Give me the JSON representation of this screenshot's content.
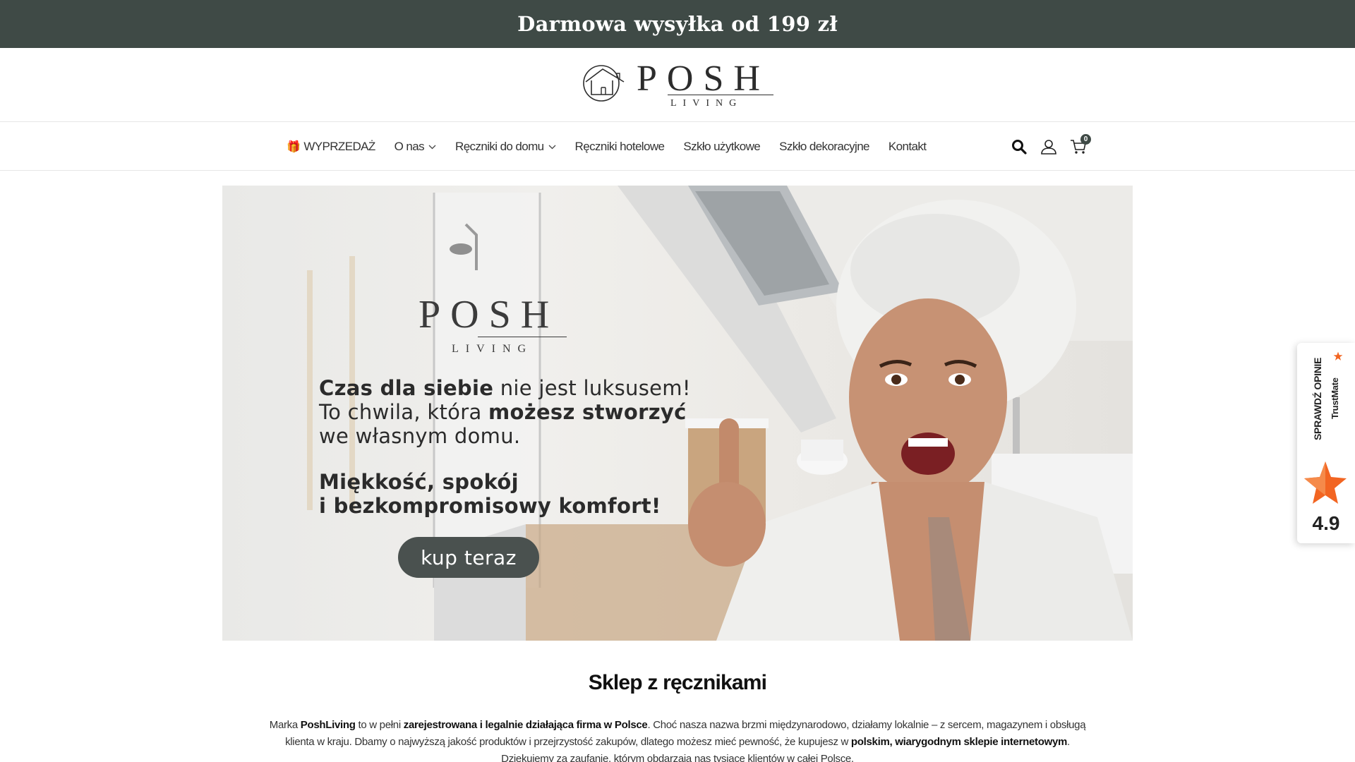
{
  "announcement": {
    "text": "Darmowa wysyłka od 199 zł"
  },
  "brand": {
    "name": "POSH",
    "sub": "LIVING"
  },
  "nav": {
    "items": [
      {
        "label": "WYPRZEDAŻ",
        "icon": "gift-icon"
      },
      {
        "label": "O nas",
        "dropdown": true
      },
      {
        "label": "Ręczniki do domu",
        "dropdown": true
      },
      {
        "label": "Ręczniki hotelowe"
      },
      {
        "label": "Szkło użytkowe"
      },
      {
        "label": "Szkło dekoracyjne"
      },
      {
        "label": "Kontakt"
      }
    ],
    "icons": [
      "search-icon",
      "user-icon",
      "cart-icon"
    ],
    "cart_count": "0"
  },
  "hero": {
    "logo_name": "POSH",
    "logo_sub": "LIVING",
    "line1_bold": "Czas dla siebie",
    "line1_rest": " nie jest luksusem!",
    "line2_start": "To chwila, która ",
    "line2_bold": "możesz stworzyć",
    "line3": "we własnym domu.",
    "line4": "Miękkość, spokój",
    "line5": "i bezkompromisowy komfort!",
    "cta": "kup teraz"
  },
  "section": {
    "title": "Sklep z ręcznikami",
    "p1": "Marka ",
    "p1_b1": "PoshLiving",
    "p1_2": " to w pełni ",
    "p1_b2": "zarejestrowana i legalnie działająca firma w Polsce",
    "p1_3": ". Choć nasza nazwa brzmi międzynarodowo, działamy lokalnie – z sercem, magazynem i obsługą klienta w kraju. Dbamy o najwyższą jakość produktów i przejrzystość zakupów, dlatego możesz mieć pewność, że kupujesz w ",
    "p1_b3": "polskim, wiarygodnym sklepie internetowym",
    "p1_4": ".",
    "p2": "Dziękujemy za zaufanie, którym obdarzają nas tysiące klientów w całej Polsce."
  },
  "trustmate": {
    "label": "SPRAWDŹ OPINIE",
    "brand": "TrustMate",
    "score": "4.9",
    "accent": "#f26522"
  },
  "colors": {
    "topbar": "#3f4a46",
    "button": "#4a514f"
  }
}
